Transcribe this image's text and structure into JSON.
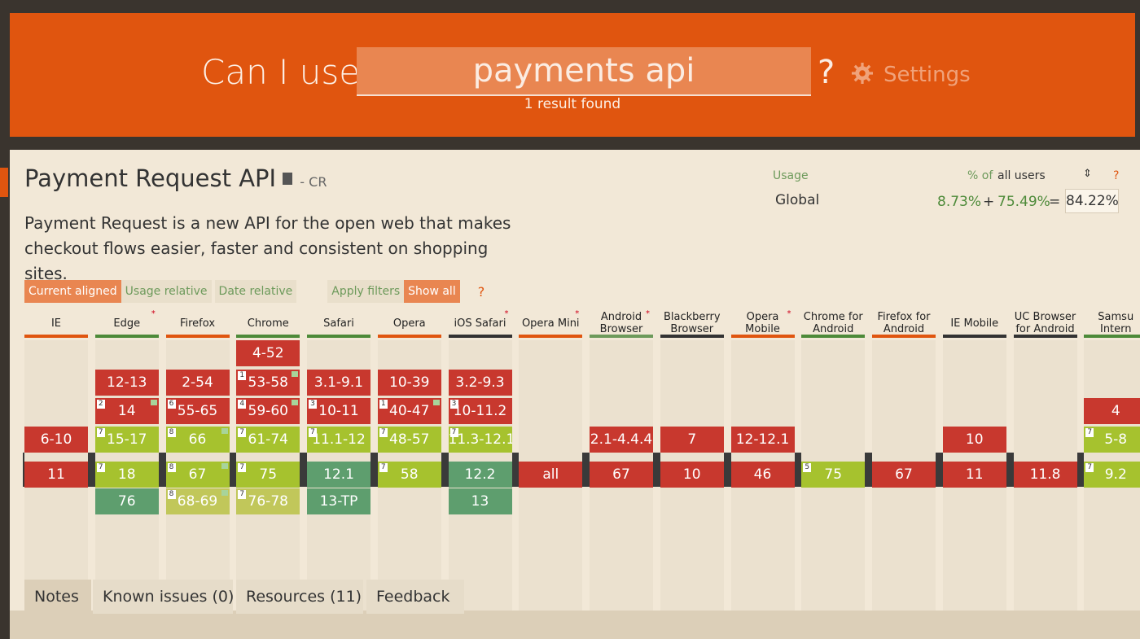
{
  "header": {
    "can_i_use": "Can I use",
    "search_value": "payments api",
    "question": "?",
    "settings": "Settings",
    "result_count": "1 result found",
    "colors": {
      "brand": "#e0550f"
    }
  },
  "feature": {
    "title": "Payment Request API",
    "status": "- CR",
    "description": "Payment Request is a new API for the open web that makes checkout flows easier, faster and consistent on shopping sites."
  },
  "usage": {
    "label": "Usage",
    "pct_of": "% of",
    "scope": "all users",
    "help": "?",
    "region": "Global",
    "partial": "8.73%",
    "plus": "+",
    "full": "75.49%",
    "equals": "=",
    "total": "84.22%"
  },
  "filters": {
    "current_aligned": "Current aligned",
    "usage_relative": "Usage relative",
    "date_relative": "Date relative",
    "apply_filters": "Apply filters",
    "show_all": "Show all",
    "help": "?"
  },
  "browsers": [
    {
      "name": "IE",
      "line": "#e0550f"
    },
    {
      "name": "Edge",
      "line": "#4d8a39",
      "star": true
    },
    {
      "name": "Firefox",
      "line": "#e0550f"
    },
    {
      "name": "Chrome",
      "line": "#4d8a39"
    },
    {
      "name": "Safari",
      "line": "#4d8a39"
    },
    {
      "name": "Opera",
      "line": "#e0550f"
    },
    {
      "name": "iOS Safari",
      "line": "#333333",
      "star": true
    },
    {
      "name": "Opera Mini",
      "line": "#e0550f",
      "star": true
    },
    {
      "name": "Android Browser",
      "line": "#6d9a5b",
      "star": true
    },
    {
      "name": "Blackberry Browser",
      "line": "#333333"
    },
    {
      "name": "Opera Mobile",
      "line": "#e0550f",
      "star": true
    },
    {
      "name": "Chrome for Android",
      "line": "#4d8a39"
    },
    {
      "name": "Firefox for Android",
      "line": "#e0550f"
    },
    {
      "name": "IE Mobile",
      "line": "#333333"
    },
    {
      "name": "UC Browser for Android",
      "line": "#333333"
    },
    {
      "name": "Samsu Intern",
      "line": "#4d8a39"
    }
  ],
  "cells": [
    {
      "col": 3,
      "row": 0,
      "text": "4-52",
      "s": "n"
    },
    {
      "col": 1,
      "row": 1,
      "text": "12-13",
      "s": "n"
    },
    {
      "col": 2,
      "row": 1,
      "text": "2-54",
      "s": "n"
    },
    {
      "col": 3,
      "row": 1,
      "text": "53-58",
      "s": "n",
      "note": "1",
      "flag": true
    },
    {
      "col": 4,
      "row": 1,
      "text": "3.1-9.1",
      "s": "n"
    },
    {
      "col": 5,
      "row": 1,
      "text": "10-39",
      "s": "n"
    },
    {
      "col": 6,
      "row": 1,
      "text": "3.2-9.3",
      "s": "n"
    },
    {
      "col": 1,
      "row": 2,
      "text": "14",
      "s": "n",
      "note": "2",
      "flag": true
    },
    {
      "col": 2,
      "row": 2,
      "text": "55-65",
      "s": "n",
      "note": "6"
    },
    {
      "col": 3,
      "row": 2,
      "text": "59-60",
      "s": "n",
      "note": "4",
      "flag": true
    },
    {
      "col": 4,
      "row": 2,
      "text": "10-11",
      "s": "n",
      "note": "3"
    },
    {
      "col": 5,
      "row": 2,
      "text": "40-47",
      "s": "n",
      "note": "1",
      "flag": true
    },
    {
      "col": 6,
      "row": 2,
      "text": "10-11.2",
      "s": "n",
      "note": "3"
    },
    {
      "col": 15,
      "row": 2,
      "text": "4",
      "s": "n"
    },
    {
      "col": 0,
      "row": 3,
      "text": "6-10",
      "s": "n"
    },
    {
      "col": 1,
      "row": 3,
      "text": "15-17",
      "s": "p",
      "note": "7"
    },
    {
      "col": 2,
      "row": 3,
      "text": "66",
      "s": "p",
      "note": "8",
      "flag": true
    },
    {
      "col": 3,
      "row": 3,
      "text": "61-74",
      "s": "p",
      "note": "7"
    },
    {
      "col": 4,
      "row": 3,
      "text": "11.1-12",
      "s": "p",
      "note": "7"
    },
    {
      "col": 5,
      "row": 3,
      "text": "48-57",
      "s": "p",
      "note": "7"
    },
    {
      "col": 6,
      "row": 3,
      "text": "11.3-12.1",
      "s": "p",
      "note": "7"
    },
    {
      "col": 8,
      "row": 3,
      "text": "2.1-4.4.4",
      "s": "n"
    },
    {
      "col": 9,
      "row": 3,
      "text": "7",
      "s": "n"
    },
    {
      "col": 10,
      "row": 3,
      "text": "12-12.1",
      "s": "n"
    },
    {
      "col": 13,
      "row": 3,
      "text": "10",
      "s": "n"
    },
    {
      "col": 15,
      "row": 3,
      "text": "5-8",
      "s": "p",
      "note": "7"
    },
    {
      "col": 0,
      "row": 4,
      "text": "11",
      "s": "n"
    },
    {
      "col": 1,
      "row": 4,
      "text": "18",
      "s": "p",
      "note": "7"
    },
    {
      "col": 2,
      "row": 4,
      "text": "67",
      "s": "p",
      "note": "8",
      "flag": true
    },
    {
      "col": 3,
      "row": 4,
      "text": "75",
      "s": "p",
      "note": "7"
    },
    {
      "col": 4,
      "row": 4,
      "text": "12.1",
      "s": "y"
    },
    {
      "col": 5,
      "row": 4,
      "text": "58",
      "s": "p",
      "note": "7"
    },
    {
      "col": 6,
      "row": 4,
      "text": "12.2",
      "s": "y"
    },
    {
      "col": 7,
      "row": 4,
      "text": "all",
      "s": "n"
    },
    {
      "col": 8,
      "row": 4,
      "text": "67",
      "s": "n"
    },
    {
      "col": 9,
      "row": 4,
      "text": "10",
      "s": "n"
    },
    {
      "col": 10,
      "row": 4,
      "text": "46",
      "s": "n"
    },
    {
      "col": 11,
      "row": 4,
      "text": "75",
      "s": "p",
      "note": "5"
    },
    {
      "col": 12,
      "row": 4,
      "text": "67",
      "s": "n"
    },
    {
      "col": 13,
      "row": 4,
      "text": "11",
      "s": "n"
    },
    {
      "col": 14,
      "row": 4,
      "text": "11.8",
      "s": "n"
    },
    {
      "col": 15,
      "row": 4,
      "text": "9.2",
      "s": "p",
      "note": "7"
    },
    {
      "col": 1,
      "row": 5,
      "text": "76",
      "s": "y"
    },
    {
      "col": 2,
      "row": 5,
      "text": "68-69",
      "s": "pf",
      "note": "8",
      "flag": true
    },
    {
      "col": 3,
      "row": 5,
      "text": "76-78",
      "s": "pf",
      "note": "7"
    },
    {
      "col": 4,
      "row": 5,
      "text": "13-TP",
      "s": "y"
    },
    {
      "col": 6,
      "row": 5,
      "text": "13",
      "s": "y"
    }
  ],
  "support_colors": {
    "n": "#c8382e",
    "p": "#a6c22e",
    "y": "#5e9e6e",
    "pf": "#c1c75a"
  },
  "tabs": [
    "Notes",
    "Known issues (0)",
    "Resources (11)",
    "Feedback"
  ]
}
